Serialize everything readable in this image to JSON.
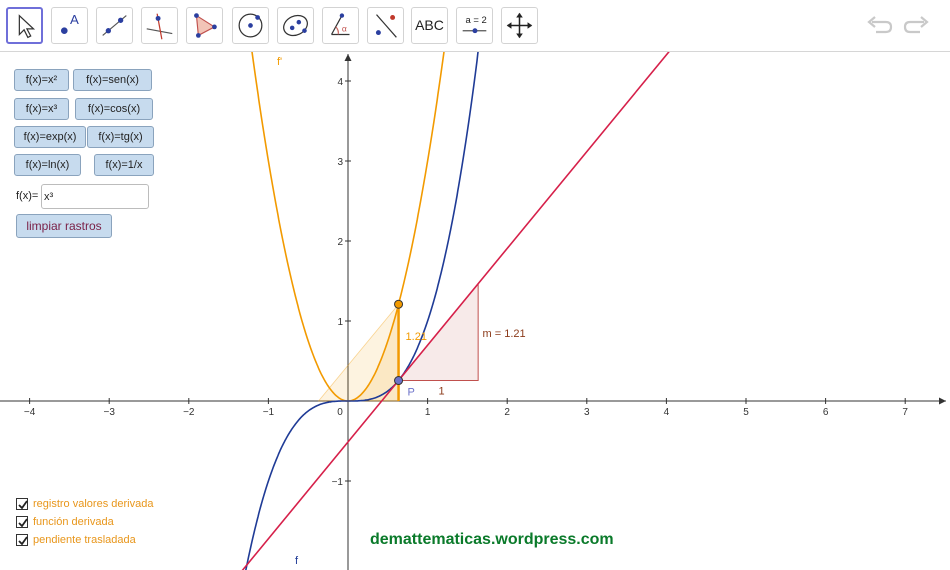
{
  "toolbar": {
    "tools": [
      {
        "name": "move-tool",
        "icon": "arrow-cursor-icon"
      },
      {
        "name": "point-tool",
        "icon": "point-icon",
        "label": "A"
      },
      {
        "name": "line-tool",
        "icon": "line-through-points-icon"
      },
      {
        "name": "perpendicular-tool",
        "icon": "perpendicular-line-icon"
      },
      {
        "name": "polygon-tool",
        "icon": "polygon-icon"
      },
      {
        "name": "circle-tool",
        "icon": "circle-center-point-icon"
      },
      {
        "name": "conic-tool",
        "icon": "ellipse-icon"
      },
      {
        "name": "angle-tool",
        "icon": "angle-icon",
        "label": "α"
      },
      {
        "name": "reflect-tool",
        "icon": "reflect-about-line-icon"
      },
      {
        "name": "text-tool",
        "icon": "text-icon",
        "label": "ABC"
      },
      {
        "name": "slider-tool",
        "icon": "slider-icon",
        "label": "a = 2"
      },
      {
        "name": "move-view-tool",
        "icon": "move-graphics-view-icon"
      }
    ],
    "undo_icon": "undo-icon",
    "redo_icon": "redo-icon"
  },
  "function_buttons": [
    [
      "f(x)=x²",
      "f(x)=sen(x)"
    ],
    [
      "f(x)=x³",
      "f(x)=cos(x)"
    ],
    [
      "f(x)=exp(x)",
      "f(x)=tg(x)"
    ],
    [
      "f(x)=ln(x)",
      "f(x)=1/x"
    ]
  ],
  "input": {
    "label": "f(x)=",
    "value": "x³"
  },
  "clear_button": "limpiar rastros",
  "checkboxes": [
    {
      "label": "registro valores derivada",
      "checked": true
    },
    {
      "label": "función derivada",
      "checked": true
    },
    {
      "label": "pendiente trasladada",
      "checked": true
    }
  ],
  "watermark": "demattematicas.wordpress.com",
  "graph": {
    "x_ticks": [
      "−4",
      "−3",
      "−2",
      "−1",
      "0",
      "1",
      "2",
      "3",
      "4",
      "5",
      "6",
      "7"
    ],
    "y_ticks": [
      "−1",
      "1",
      "2",
      "3",
      "4"
    ],
    "point_label": "P",
    "slope_label": "m = 1.21",
    "run_label": "1",
    "rise_label": "1.21",
    "f_label": "f",
    "fprime_label": "f'",
    "point_x": 0.635,
    "colors": {
      "f": "#1f3b96",
      "fprime": "#f29a00",
      "tangent": "#d6204a",
      "slope": "#c0504d",
      "point": "#6c72c9"
    }
  }
}
